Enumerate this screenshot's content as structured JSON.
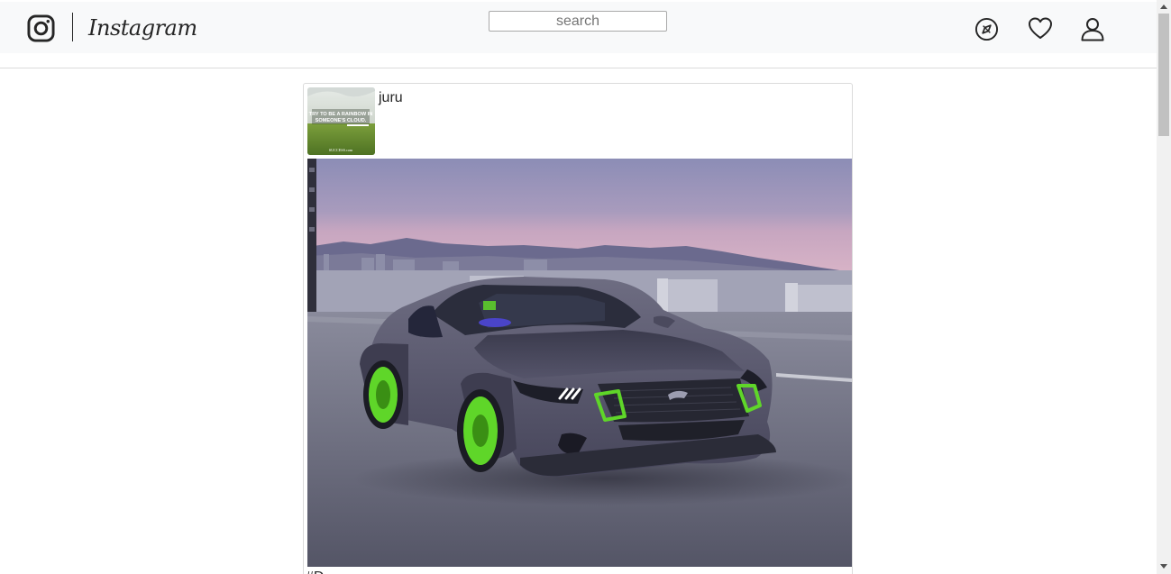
{
  "header": {
    "brand": "Instagram",
    "search": {
      "placeholder": "search",
      "value": ""
    },
    "icons": [
      "instagram-glyph-icon",
      "explore-compass-icon",
      "heart-icon",
      "user-profile-icon"
    ]
  },
  "post": {
    "username": "juru",
    "caption": "#D",
    "avatar_text": {
      "line1": "TRY TO BE A RAINBOW IN",
      "line2": "SOMEONE'S CLOUD.",
      "footer": "SUCCESS.com"
    }
  },
  "colors": {
    "header_bg": "#f8f9fa",
    "text": "#262626",
    "border": "#dbdbdb",
    "wheel_green": "#5fd629",
    "car_body": "#5b5a6e"
  }
}
